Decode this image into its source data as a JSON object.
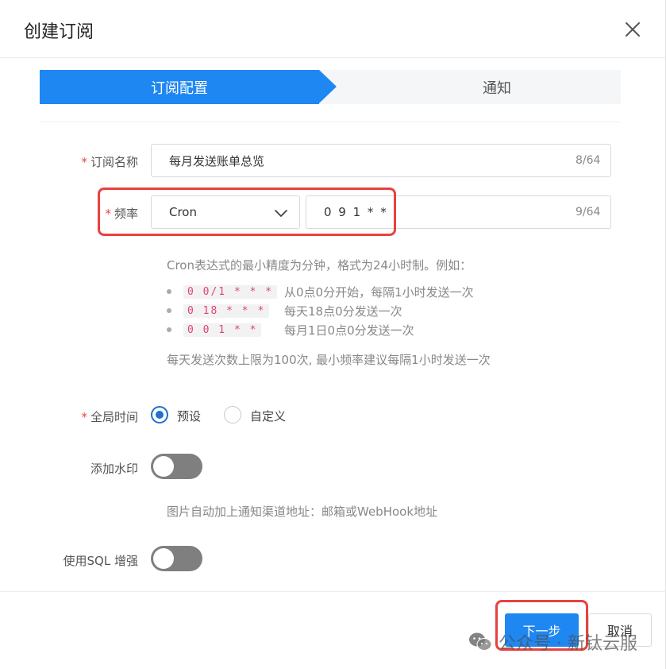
{
  "dialog": {
    "title": "创建订阅"
  },
  "steps": [
    {
      "label": "订阅配置",
      "active": true
    },
    {
      "label": "通知",
      "active": false
    }
  ],
  "form": {
    "name": {
      "label": "订阅名称",
      "required": true,
      "value": "每月发送账单总览",
      "counter": "8/64"
    },
    "frequency": {
      "label": "频率",
      "required": true,
      "type_value": "Cron",
      "cron_value": "0 9 1 * *",
      "counter": "9/64"
    },
    "cron_help": {
      "intro": "Cron表达式的最小精度为分钟，格式为24小时制。例如：",
      "examples": [
        {
          "code": "0 0/1 * * *",
          "desc": "从0点0分开始，每隔1小时发送一次"
        },
        {
          "code": "0 18 * * *",
          "desc": "每天18点0分发送一次"
        },
        {
          "code": "0 0 1 * *",
          "desc": "每月1日0点0分发送一次"
        }
      ],
      "limit": "每天发送次数上限为100次, 最小频率建议每隔1小时发送一次"
    },
    "global_time": {
      "label": "全局时间",
      "required": true,
      "options": [
        {
          "label": "预设",
          "selected": true
        },
        {
          "label": "自定义",
          "selected": false
        }
      ]
    },
    "watermark": {
      "label": "添加水印",
      "enabled": false,
      "help": "图片自动加上通知渠道地址：邮箱或WebHook地址"
    },
    "sql_enhance": {
      "label": "使用SQL 增强",
      "enabled": false
    }
  },
  "footer": {
    "next_label": "下一步",
    "cancel_label": "取消"
  },
  "overlay_watermark": {
    "text": "公众号 · 新钛云服"
  },
  "colors": {
    "primary": "#1f87f2",
    "highlight": "#e8423f",
    "required": "#e54545",
    "radio": "#1f6fd4"
  }
}
